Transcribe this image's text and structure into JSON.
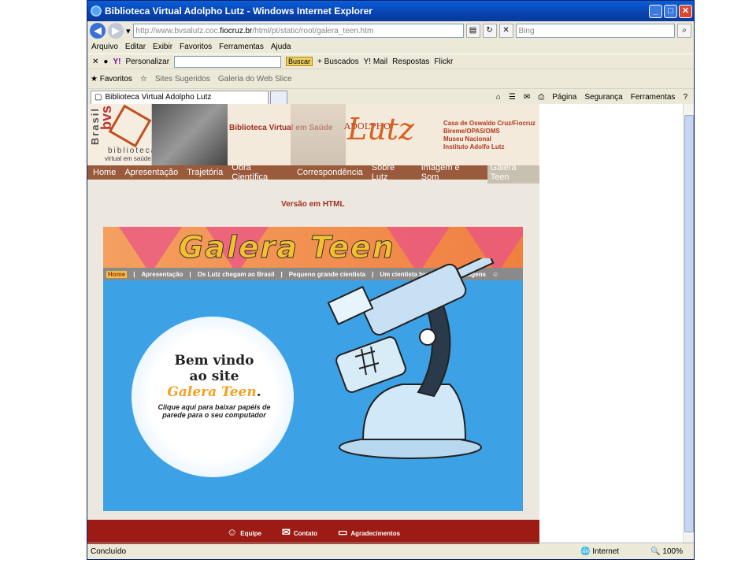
{
  "window": {
    "title": "Biblioteca Virtual Adolpho Lutz - Windows Internet Explorer"
  },
  "address": {
    "prefix": "http://www.bvsalutz.coc.",
    "domain": "fiocruz.br",
    "path": "/html/pt/static/root/galera_teen.htm",
    "search_placeholder": "Bing"
  },
  "menu": [
    "Arquivo",
    "Editar",
    "Exibir",
    "Favoritos",
    "Ferramentas",
    "Ajuda"
  ],
  "yahoo_toolbar": {
    "personalizar": "Personalizar",
    "buscar": "Buscar",
    "buscados": "+ Buscados",
    "mail": "Y! Mail",
    "respostas": "Respostas",
    "flickr": "Flickr"
  },
  "favorites_bar": {
    "favoritos": "Favoritos",
    "sites": "Sites Sugeridos",
    "galeria": "Galeria do Web Slice"
  },
  "tab": {
    "label": "Biblioteca Virtual Adolpho Lutz"
  },
  "command_bar": {
    "pagina": "Página",
    "seguranca": "Segurança",
    "ferramentas": "Ferramentas"
  },
  "header": {
    "brasil": "Brasil",
    "bvs": "bvs",
    "biblioteca": "biblioteca",
    "virtual": "virtual em saúde",
    "site_title": "Biblioteca Virtual em Saúde",
    "adolpho": "ADOLPHO",
    "lutz": "Lutz",
    "partners": [
      "Casa de Oswaldo Cruz/Fiocruz",
      "Bireme/OPAS/OMS",
      "Museu Nacional",
      "Instituto Adolfo Lutz"
    ]
  },
  "nav": [
    "Home",
    "Apresentação",
    "Trajetória",
    "Obra Científica",
    "Correspondência",
    "Sobre Lutz",
    "Imagem e Som"
  ],
  "nav_active": "Galera Teen",
  "versao": "Versão em HTML",
  "galera": {
    "title": "Galera Teen",
    "nav": [
      "Home",
      "Apresentação",
      "Os Lutz chegam ao Brasil",
      "Pequeno grande cientista",
      "Um cientista brasileiro",
      "Viagens"
    ],
    "welcome_1": "Bem vindo",
    "welcome_2": "ao site",
    "welcome_3": "Galera Teen",
    "welcome_dot": ".",
    "click_text": "Clique aqui para baixar papéis de parede para o seu computador"
  },
  "footer": [
    "Equipe",
    "Contato",
    "Agradecimentos"
  ],
  "status": {
    "left": "Concluído",
    "zone": "Internet",
    "zoom": "100%"
  },
  "colors": {
    "nav_bg": "#9a5a3c",
    "footer_bg": "#9c1b14",
    "galera_bg": "#3da1e6",
    "title_yellow": "#f4c030"
  }
}
